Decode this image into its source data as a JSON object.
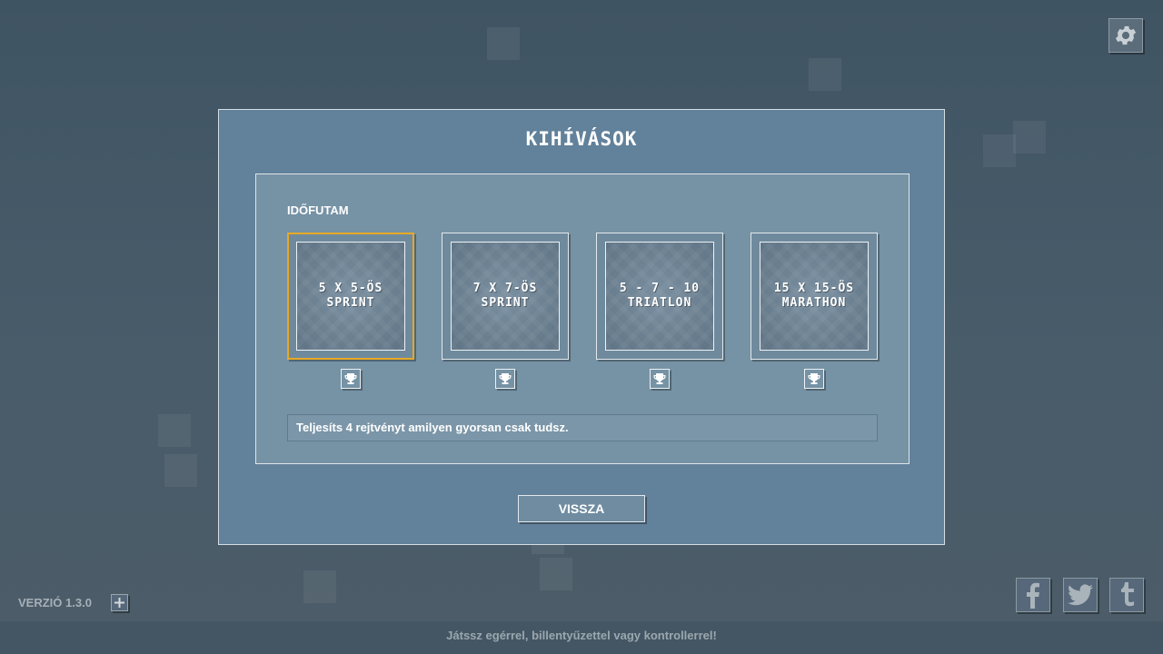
{
  "dialog": {
    "title": "KIHÍVÁSOK",
    "section_label": "IDŐFUTAM",
    "description": "Teljesíts 4 rejtvényt amilyen gyorsan csak tudsz.",
    "back_label": "VISSZA"
  },
  "challenges": [
    {
      "line1": "5 X 5-ÖS",
      "line2": "SPRINT",
      "selected": true,
      "trophy_icon": "trophy-icon"
    },
    {
      "line1": "7 X 7-ÖS",
      "line2": "SPRINT",
      "selected": false,
      "trophy_icon": "trophy-icon"
    },
    {
      "line1": "5 - 7 - 10",
      "line2": "TRIATLON",
      "selected": false,
      "trophy_icon": "trophy-icon"
    },
    {
      "line1": "15 X 15-ÖS",
      "line2": "MARATHON",
      "selected": false,
      "trophy_icon": "trophy-icon"
    }
  ],
  "footer": {
    "version": "VERZIÓ 1.3.0",
    "hint": "Játssz egérrel, billentyűzettel vagy kontrollerrel!"
  },
  "icons": {
    "settings": "gear-icon",
    "plus": "plus-icon",
    "facebook": "facebook-icon",
    "twitter": "twitter-icon",
    "tumblr": "tumblr-icon"
  },
  "colors": {
    "selected_border": "#e6a925",
    "dialog_bg": "#62819a",
    "panel_bg": "#7692a5"
  }
}
